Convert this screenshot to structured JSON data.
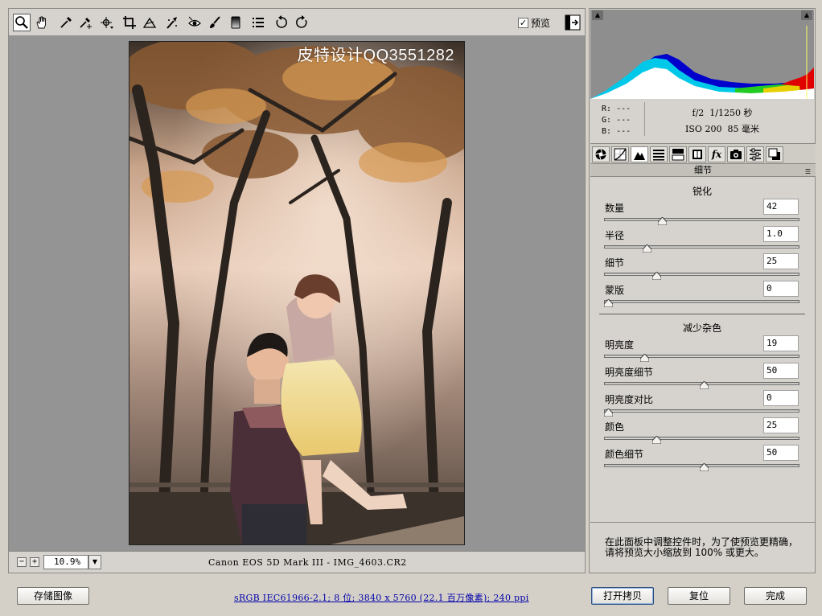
{
  "toolbar": {
    "tools": [
      "zoom-tool",
      "hand-tool",
      "white-balance-tool",
      "color-sampler-tool",
      "target-adjustment-tool",
      "crop-tool",
      "straighten-tool",
      "spot-removal-tool",
      "red-eye-removal-tool",
      "adjustment-brush-tool",
      "graduated-filter-tool",
      "open-preferences",
      "rotate-ccw",
      "rotate-cw"
    ],
    "preview_label": "预览",
    "preview_checked": true
  },
  "photo": {
    "watermark": "皮特设计QQ3551282"
  },
  "status_bar": {
    "zoom_value": "10.9%",
    "camera_file": "Canon EOS 5D Mark III -  IMG_4603.CR2"
  },
  "info": {
    "r_label": "R:",
    "r_value": "---",
    "g_label": "G:",
    "g_value": "---",
    "b_label": "B:",
    "b_value": "---",
    "aperture": "f/2",
    "shutter": "1/1250 秒",
    "iso": "ISO 200",
    "focal": "85 毫米"
  },
  "tabs": [
    "basic",
    "tone-curve",
    "detail",
    "hsl-grayscale",
    "split-toning",
    "lens-corrections",
    "fx-effects",
    "camera-calibration",
    "presets",
    "snapshots"
  ],
  "panel": {
    "section_title": "细节",
    "sharpening": {
      "heading": "锐化",
      "sliders": [
        {
          "label": "数量",
          "value": "42",
          "min": 0,
          "max": 150
        },
        {
          "label": "半径",
          "value": "1.0",
          "min": 0.5,
          "max": 3.0
        },
        {
          "label": "细节",
          "value": "25",
          "min": 0,
          "max": 100
        },
        {
          "label": "蒙版",
          "value": "0",
          "min": 0,
          "max": 100
        }
      ]
    },
    "noise": {
      "heading": "减少杂色",
      "sliders": [
        {
          "label": "明亮度",
          "value": "19",
          "min": 0,
          "max": 100
        },
        {
          "label": "明亮度细节",
          "value": "50",
          "min": 0,
          "max": 100
        },
        {
          "label": "明亮度对比",
          "value": "0",
          "min": 0,
          "max": 100
        },
        {
          "label": "颜色",
          "value": "25",
          "min": 0,
          "max": 100
        },
        {
          "label": "颜色细节",
          "value": "50",
          "min": 0,
          "max": 100
        }
      ]
    },
    "hint_line1": "在此面板中调整控件时，为了使预览更精确，",
    "hint_line2": "请将预览大小缩放到 100% 或更大。"
  },
  "bottom": {
    "save_label": "存储图像",
    "workflow_text": "sRGB IEC61966-2.1; 8 位; 3840 x 5760 (22.1 百万像素); 240 ppi",
    "open_copy_label": "打开拷贝",
    "reset_label": "复位",
    "done_label": "完成"
  },
  "colors": {
    "canvas_bg": "#949494",
    "panel_bg": "#d6d3ce",
    "histogram_bg": "#8e8e8e",
    "link": "#0000aa"
  }
}
